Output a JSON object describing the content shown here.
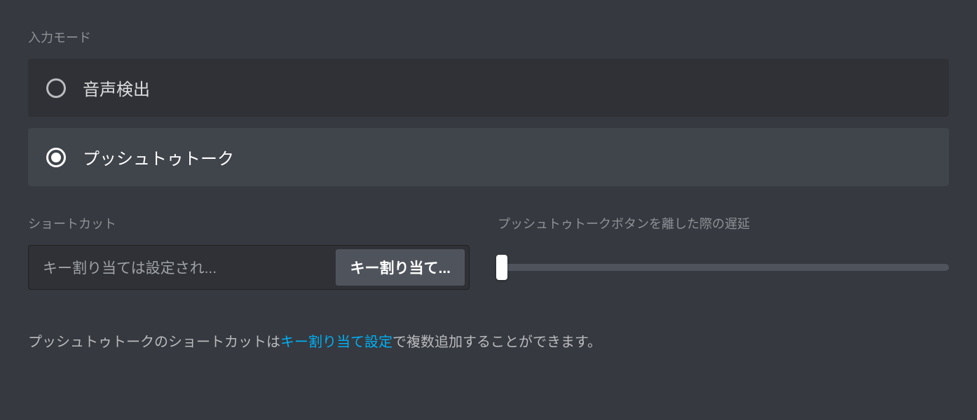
{
  "input_mode": {
    "label": "入力モード",
    "options": [
      {
        "label": "音声検出",
        "selected": false
      },
      {
        "label": "プッシュトゥトーク",
        "selected": true
      }
    ]
  },
  "shortcut": {
    "label": "ショートカット",
    "placeholder": "キー割り当ては設定され...",
    "button": "キー割り当て..."
  },
  "delay": {
    "label": "プッシュトゥトークボタンを離した際の遅延",
    "value_percent": 2
  },
  "footer": {
    "text_before": "プッシュトゥトークのショートカットは",
    "link": "キー割り当て設定",
    "text_after": "で複数追加することができます。"
  }
}
